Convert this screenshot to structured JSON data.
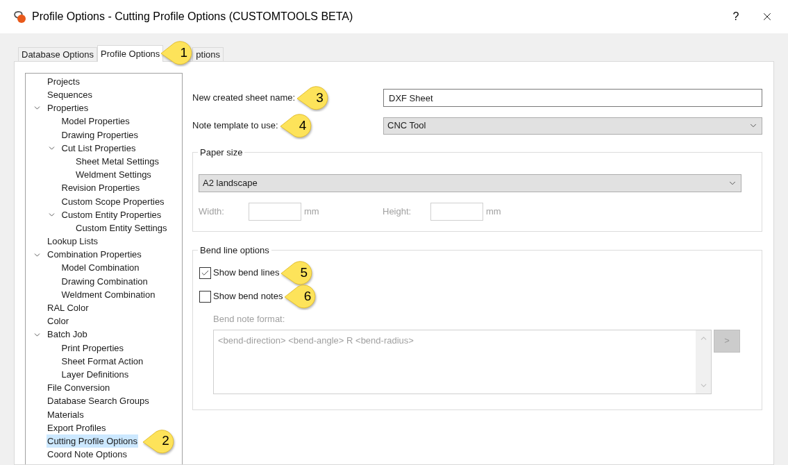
{
  "window": {
    "title": "Profile Options - Cutting Profile Options (CUSTOMTOOLS BETA)",
    "help": "?"
  },
  "tabs": [
    {
      "label": "Database Options",
      "selected": false
    },
    {
      "label": "Profile Options",
      "selected": true,
      "callout": "1"
    },
    {
      "label": "ptions",
      "selected": false
    }
  ],
  "tree": [
    {
      "label": "Projects",
      "selected": false
    },
    {
      "label": "Sequences",
      "selected": false
    },
    {
      "label": "Properties",
      "selected": false,
      "expanded": true,
      "children": [
        {
          "label": "Model Properties",
          "selected": false
        },
        {
          "label": "Drawing Properties",
          "selected": false
        },
        {
          "label": "Cut List Properties",
          "selected": false,
          "expanded": true,
          "children": [
            {
              "label": "Sheet Metal Settings",
              "selected": false
            },
            {
              "label": "Weldment Settings",
              "selected": false
            }
          ]
        },
        {
          "label": "Revision Properties",
          "selected": false
        },
        {
          "label": "Custom Scope Properties",
          "selected": false
        },
        {
          "label": "Custom Entity Properties",
          "selected": false,
          "expanded": true,
          "children": [
            {
              "label": "Custom Entity Settings",
              "selected": false
            }
          ]
        }
      ]
    },
    {
      "label": "Lookup Lists",
      "selected": false
    },
    {
      "label": "Combination Properties",
      "selected": false,
      "expanded": true,
      "children": [
        {
          "label": "Model Combination",
          "selected": false
        },
        {
          "label": "Drawing Combination",
          "selected": false
        },
        {
          "label": "Weldment Combination",
          "selected": false
        }
      ]
    },
    {
      "label": "RAL Color",
      "selected": false
    },
    {
      "label": "Color",
      "selected": false
    },
    {
      "label": "Batch Job",
      "selected": false,
      "expanded": true,
      "children": [
        {
          "label": "Print Properties",
          "selected": false
        },
        {
          "label": "Sheet Format Action",
          "selected": false
        },
        {
          "label": "Layer Definitions",
          "selected": false
        }
      ]
    },
    {
      "label": "File Conversion",
      "selected": false
    },
    {
      "label": "Database Search Groups",
      "selected": false
    },
    {
      "label": "Materials",
      "selected": false
    },
    {
      "label": "Export Profiles",
      "selected": false
    },
    {
      "label": "Cutting Profile Options",
      "selected": true,
      "callout": "2"
    },
    {
      "label": "Coord Note Options",
      "selected": false
    }
  ],
  "sheet_name": {
    "label": "New created sheet name:",
    "value": "DXF Sheet",
    "callout": "3"
  },
  "note_template": {
    "label": "Note template to use:",
    "value": "CNC Tool",
    "callout": "4"
  },
  "paper_size": {
    "title": "Paper size",
    "value": "A2 landscape",
    "width_label": "Width:",
    "width_unit": "mm",
    "height_label": "Height:",
    "height_unit": "mm",
    "disabled": true
  },
  "bend_line_options": {
    "title": "Bend line options",
    "checkboxes": [
      {
        "label": "Show bend lines",
        "checked": true,
        "callout": "5"
      },
      {
        "label": "Show bend notes",
        "checked": false,
        "callout": "6"
      }
    ],
    "format_label": "Bend note format:",
    "format_value": "<bend-direction> <bend-angle> R <bend-radius>",
    "insert_button": ">",
    "disabled": true
  }
}
